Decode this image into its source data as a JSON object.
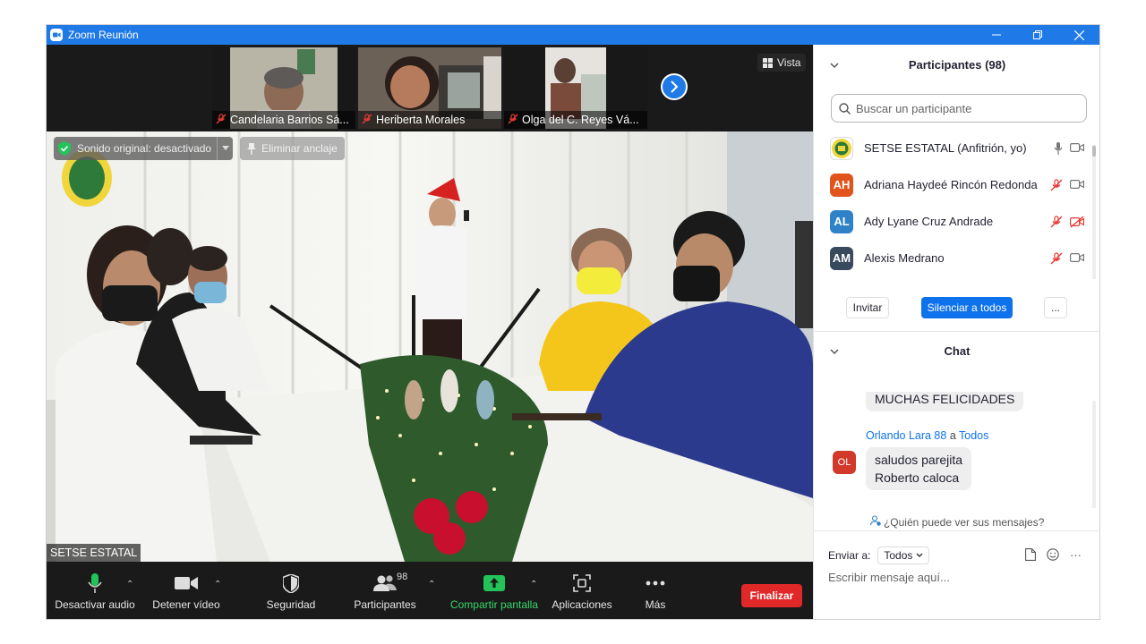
{
  "window": {
    "title": "Zoom Reunión"
  },
  "thumbnails": [
    {
      "name": "Candelaria Barrios Sá..."
    },
    {
      "name": "Heriberta Morales"
    },
    {
      "name": "Olga del C. Reyes Vá..."
    }
  ],
  "view_button": {
    "label": "Vista"
  },
  "main_video": {
    "sound_label": "Sonido original: desactivado",
    "unpin_label": "Eliminar anclaje",
    "speaker_name": "SETSE ESTATAL"
  },
  "toolbar": {
    "mute": "Desactivar audio",
    "video": "Detener vídeo",
    "security": "Seguridad",
    "participants": "Participantes",
    "participant_count": "98",
    "share": "Compartir pantalla",
    "apps": "Aplicaciones",
    "more": "Más",
    "end": "Finalizar"
  },
  "participants_panel": {
    "title": "Participantes (98)",
    "search_placeholder": "Buscar un participante",
    "items": [
      {
        "initials": "",
        "name": "SETSE ESTATAL (Anfitrión, yo)",
        "color": "#ffffff"
      },
      {
        "initials": "AH",
        "name": "Adriana Haydeé Rincón Redonda",
        "color": "#e1541b"
      },
      {
        "initials": "AL",
        "name": "Ady Lyane Cruz Andrade",
        "color": "#2f82c8"
      },
      {
        "initials": "AM",
        "name": "Alexis Medrano",
        "color": "#3a4a5e"
      }
    ],
    "invite": "Invitar",
    "mute_all": "Silenciar a todos",
    "more": "..."
  },
  "chat": {
    "title": "Chat",
    "prev_message": "MUCHAS FELICIDADES",
    "sender": "Orlando Lara 88",
    "to_word": "a",
    "recipient": "Todos",
    "sender_initials": "OL",
    "message_line1": "saludos parejita",
    "message_line2": "Roberto caloca",
    "who_can_see": "¿Quién puede ver sus mensajes?",
    "send_to_label": "Enviar a:",
    "send_to_value": "Todos",
    "input_placeholder": "Escribir mensaje aquí...",
    "more": "···"
  }
}
